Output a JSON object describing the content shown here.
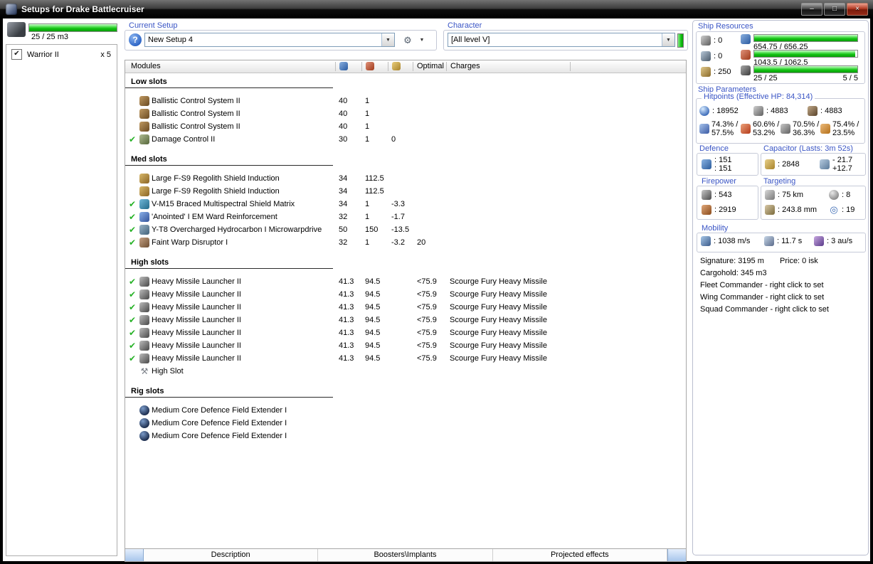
{
  "window": {
    "title": "Setups for Drake Battlecruiser"
  },
  "icons": {
    "help": "?",
    "dropdown": "▼",
    "check": "✔",
    "wrench": "⚒",
    "gear": "⚙",
    "minimize": "–",
    "maximize": "□",
    "close": "×",
    "sensor": "◎"
  },
  "drone_bay": {
    "capacity_text": "25 / 25 m3",
    "fill": 100,
    "items": [
      {
        "name": "Warrior II",
        "qty": "x 5",
        "checked": true
      }
    ]
  },
  "current_setup": {
    "label": "Current Setup",
    "value": "New Setup 4"
  },
  "character": {
    "label": "Character",
    "value": "[All level V]"
  },
  "modules_table": {
    "col_modules": "Modules",
    "col_optimal": "Optimal",
    "col_charges": "Charges",
    "sections": [
      {
        "title": "Low slots",
        "rows": [
          {
            "fitted": false,
            "icon": "ballistic-control",
            "name": "Ballistic Control System II",
            "cpu": "40",
            "pg": "1",
            "cap": "",
            "optimal": "",
            "charges": ""
          },
          {
            "fitted": false,
            "icon": "ballistic-control",
            "name": "Ballistic Control System II",
            "cpu": "40",
            "pg": "1",
            "cap": "",
            "optimal": "",
            "charges": ""
          },
          {
            "fitted": false,
            "icon": "ballistic-control",
            "name": "Ballistic Control System II",
            "cpu": "40",
            "pg": "1",
            "cap": "",
            "optimal": "",
            "charges": ""
          },
          {
            "fitted": true,
            "icon": "damage-control",
            "name": "Damage Control II",
            "cpu": "30",
            "pg": "1",
            "cap": "0",
            "optimal": "",
            "charges": ""
          }
        ]
      },
      {
        "title": "Med slots",
        "rows": [
          {
            "fitted": false,
            "icon": "shield-extender",
            "name": "Large F-S9 Regolith Shield Induction",
            "cpu": "34",
            "pg": "112.5",
            "cap": "",
            "optimal": "",
            "charges": ""
          },
          {
            "fitted": false,
            "icon": "shield-extender",
            "name": "Large F-S9 Regolith Shield Induction",
            "cpu": "34",
            "pg": "112.5",
            "cap": "",
            "optimal": "",
            "charges": ""
          },
          {
            "fitted": true,
            "icon": "shield-hardener",
            "name": "V-M15 Braced Multispectral Shield Matrix",
            "cpu": "34",
            "pg": "1",
            "cap": "-3.3",
            "optimal": "",
            "charges": ""
          },
          {
            "fitted": true,
            "icon": "em-ward",
            "name": "'Anointed' I EM Ward Reinforcement",
            "cpu": "32",
            "pg": "1",
            "cap": "-1.7",
            "optimal": "",
            "charges": ""
          },
          {
            "fitted": true,
            "icon": "mwd",
            "name": "Y-T8 Overcharged Hydrocarbon I Microwarpdrive",
            "cpu": "50",
            "pg": "150",
            "cap": "-13.5",
            "optimal": "",
            "charges": ""
          },
          {
            "fitted": true,
            "icon": "warp-disruptor",
            "name": "Faint Warp Disruptor I",
            "cpu": "32",
            "pg": "1",
            "cap": "-3.2",
            "optimal": "20",
            "charges": ""
          }
        ]
      },
      {
        "title": "High slots",
        "rows": [
          {
            "fitted": true,
            "icon": "missile-launcher",
            "name": "Heavy Missile Launcher II",
            "cpu": "41.3",
            "pg": "94.5",
            "cap": "",
            "optimal": "<75.9",
            "charges": "Scourge Fury Heavy Missile"
          },
          {
            "fitted": true,
            "icon": "missile-launcher",
            "name": "Heavy Missile Launcher II",
            "cpu": "41.3",
            "pg": "94.5",
            "cap": "",
            "optimal": "<75.9",
            "charges": "Scourge Fury Heavy Missile"
          },
          {
            "fitted": true,
            "icon": "missile-launcher",
            "name": "Heavy Missile Launcher II",
            "cpu": "41.3",
            "pg": "94.5",
            "cap": "",
            "optimal": "<75.9",
            "charges": "Scourge Fury Heavy Missile"
          },
          {
            "fitted": true,
            "icon": "missile-launcher",
            "name": "Heavy Missile Launcher II",
            "cpu": "41.3",
            "pg": "94.5",
            "cap": "",
            "optimal": "<75.9",
            "charges": "Scourge Fury Heavy Missile"
          },
          {
            "fitted": true,
            "icon": "missile-launcher",
            "name": "Heavy Missile Launcher II",
            "cpu": "41.3",
            "pg": "94.5",
            "cap": "",
            "optimal": "<75.9",
            "charges": "Scourge Fury Heavy Missile"
          },
          {
            "fitted": true,
            "icon": "missile-launcher",
            "name": "Heavy Missile Launcher II",
            "cpu": "41.3",
            "pg": "94.5",
            "cap": "",
            "optimal": "<75.9",
            "charges": "Scourge Fury Heavy Missile"
          },
          {
            "fitted": true,
            "icon": "missile-launcher",
            "name": "Heavy Missile Launcher II",
            "cpu": "41.3",
            "pg": "94.5",
            "cap": "",
            "optimal": "<75.9",
            "charges": "Scourge Fury Heavy Missile"
          },
          {
            "fitted": false,
            "icon": "wrench",
            "name": "High Slot",
            "cpu": "",
            "pg": "",
            "cap": "",
            "optimal": "",
            "charges": ""
          }
        ]
      },
      {
        "title": "Rig slots",
        "rows": [
          {
            "fitted": false,
            "icon": "rig",
            "name": "Medium Core Defence Field Extender I",
            "cpu": "",
            "pg": "",
            "cap": "",
            "optimal": "",
            "charges": ""
          },
          {
            "fitted": false,
            "icon": "rig",
            "name": "Medium Core Defence Field Extender I",
            "cpu": "",
            "pg": "",
            "cap": "",
            "optimal": "",
            "charges": ""
          },
          {
            "fitted": false,
            "icon": "rig",
            "name": "Medium Core Defence Field Extender I",
            "cpu": "",
            "pg": "",
            "cap": "",
            "optimal": "",
            "charges": ""
          }
        ]
      }
    ]
  },
  "bottom_tabs": [
    {
      "label": "Description"
    },
    {
      "label": "Boosters\\Implants"
    },
    {
      "label": "Projected effects"
    }
  ],
  "ship_resources": {
    "label": "Ship Resources",
    "turrets": ": 0",
    "launchers": ": 0",
    "calibration": ": 250",
    "cpu": {
      "text": "654.75 / 656.25",
      "fill": 99.8
    },
    "powergrid": {
      "text": "1043.5 / 1062.5",
      "fill": 98.2
    },
    "drones": {
      "text": "25 / 25",
      "extra": "5 / 5",
      "fill": 100
    }
  },
  "ship_parameters": {
    "label": "Ship Parameters",
    "hitpoints_label": "Hitpoints (Effective HP: 84,314)",
    "shield_hp": ": 18952",
    "armor_hp": ": 4883",
    "hull_hp": ": 4883",
    "resists": [
      {
        "type": "em",
        "shield": "74.3% /",
        "armor": "57.5%"
      },
      {
        "type": "thermal",
        "shield": "60.6% /",
        "armor": "53.2%"
      },
      {
        "type": "kinetic",
        "shield": "70.5% /",
        "armor": "36.3%"
      },
      {
        "type": "explosive",
        "shield": "75.4% /",
        "armor": "23.5%"
      }
    ]
  },
  "defence": {
    "label": "Defence",
    "top": ": 151",
    "bottom": ": 151"
  },
  "capacitor": {
    "label": "Capacitor (Lasts: 3m 52s)",
    "amount": ": 2848",
    "peak": "- 21.7",
    "recharge": "+12.7"
  },
  "firepower": {
    "label": "Firepower",
    "dps": ": 543",
    "volley": ": 2919"
  },
  "targeting": {
    "label": "Targeting",
    "range": ": 75 km",
    "max_targets": ": 8",
    "scan_resolution": ": 243.8 mm",
    "sensor_strength": ": 19"
  },
  "mobility": {
    "label": "Mobility",
    "speed": ": 1038 m/s",
    "align_time": ": 11.7 s",
    "warp_speed": ": 3 au/s"
  },
  "info": {
    "signature": "Signature: 3195 m",
    "price": "Price: 0 isk",
    "cargohold": "Cargohold: 345 m3",
    "fleet": "Fleet Commander - right click to set",
    "wing": "Wing Commander - right click to set",
    "squad": "Squad Commander - right click to set"
  }
}
